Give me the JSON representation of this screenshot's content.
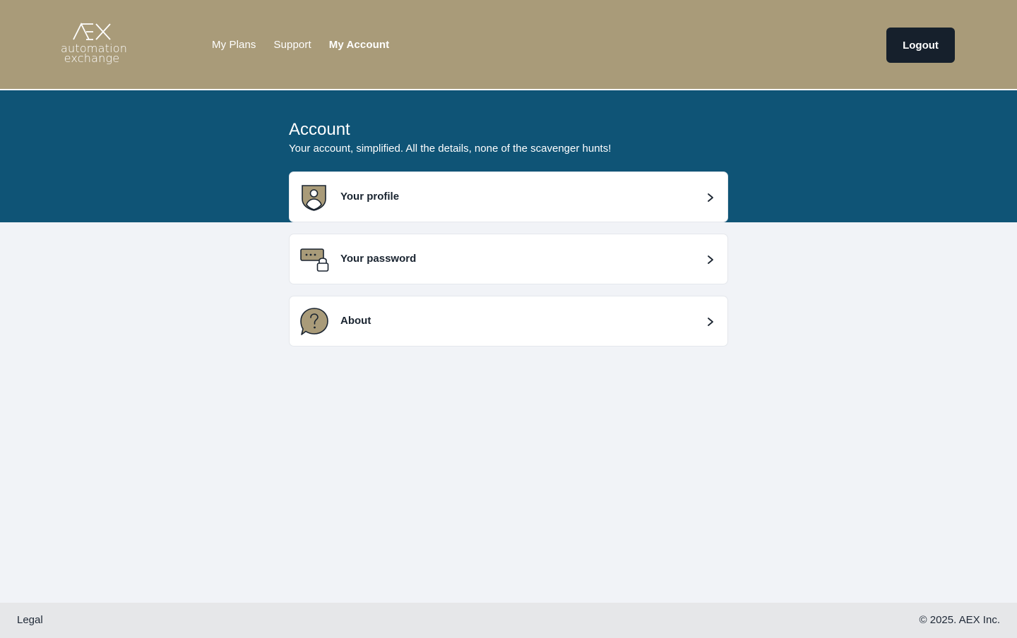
{
  "brand": {
    "logo_mark": "AEX",
    "logo_line1": "automation",
    "logo_line2": "exchange"
  },
  "nav": {
    "items": [
      {
        "label": "My Plans"
      },
      {
        "label": "Support"
      },
      {
        "label": "My Account"
      }
    ],
    "logout_label": "Logout"
  },
  "page": {
    "title": "Account",
    "subtitle": "Your account, simplified. All the details, none of the scavenger hunts!"
  },
  "cards": [
    {
      "label": "Your profile",
      "icon": "profile-shield-icon"
    },
    {
      "label": "Your password",
      "icon": "password-lock-icon"
    },
    {
      "label": "About",
      "icon": "question-bubble-icon"
    }
  ],
  "footer": {
    "legal": "Legal",
    "copyright": "© 2025. AEX Inc."
  },
  "colors": {
    "header_bg": "#a99b79",
    "band_bg": "#0f5476",
    "page_bg": "#f1f3f7",
    "button_dark": "#16202c",
    "icon_fill": "#a99b79"
  }
}
